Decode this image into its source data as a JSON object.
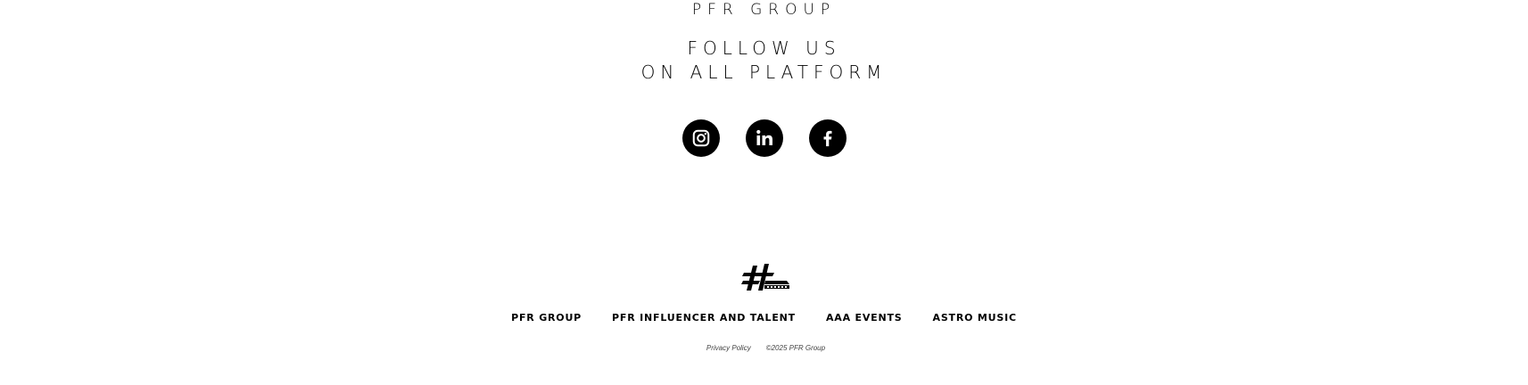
{
  "header": {
    "brand": "PFR GROUP"
  },
  "follow": {
    "line1": "FOLLOW US",
    "line2": "ON ALL PLATFORM"
  },
  "social": [
    {
      "name": "instagram-icon"
    },
    {
      "name": "linkedin-icon"
    },
    {
      "name": "facebook-icon"
    }
  ],
  "footer": {
    "logo_icon": "hashtag-logo-icon",
    "nav": {
      "pfr_group": "PFR GROUP",
      "pfr_influencer": "PFR INFLUENCER AND TALENT",
      "aaa_events": "AAA EVENTS",
      "astro_music": "ASTRO MUSIC"
    },
    "privacy": "Privacy Policy",
    "copyright": "©2025 PFR Group"
  },
  "colors": {
    "background": "#ffffff",
    "text": "#000000",
    "icon_bg": "#000000"
  }
}
